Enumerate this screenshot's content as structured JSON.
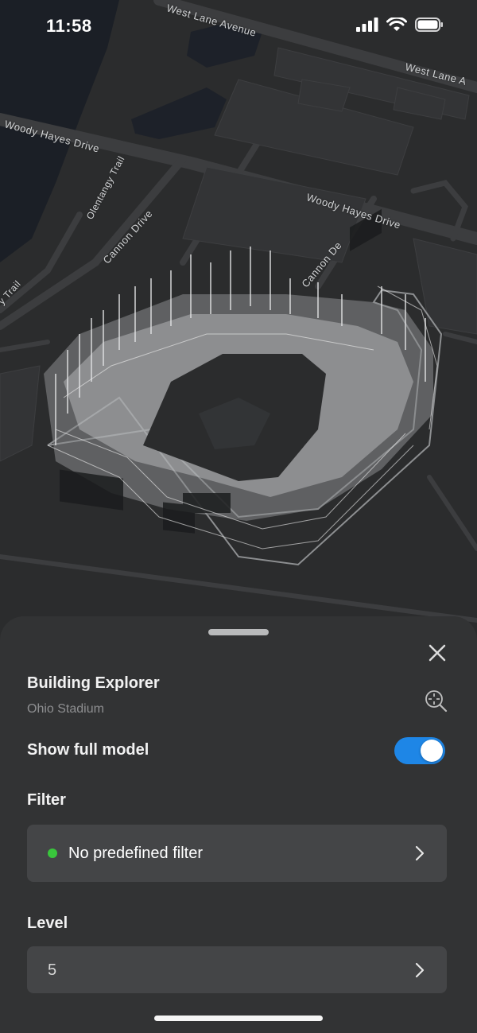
{
  "status_bar": {
    "time": "11:58"
  },
  "map": {
    "labels": {
      "west_lane_top": "West Lane Avenue",
      "west_lane_right": "West Lane A",
      "woody_left": "Woody Hayes Drive",
      "woody_right": "Woody Hayes Drive",
      "olentangy": "Olentangy Trail",
      "cannon": "Cannon Drive",
      "cannon_de": "Cannon De",
      "trail": "y Trail"
    }
  },
  "sheet": {
    "title": "Building Explorer",
    "subtitle": "Ohio Stadium",
    "show_full_model": {
      "label": "Show full model",
      "on": true
    },
    "filter": {
      "label": "Filter",
      "value": "No predefined filter",
      "indicator_color": "#39c63c"
    },
    "level": {
      "label": "Level",
      "value": "5"
    }
  },
  "colors": {
    "accent": "#1e86e6",
    "sheet_bg": "#323334",
    "row_bg": "#444547"
  },
  "icons": [
    "signal-icon",
    "wifi-icon",
    "battery-icon",
    "close-icon",
    "zoom-to-icon",
    "chevron-right-icon"
  ]
}
